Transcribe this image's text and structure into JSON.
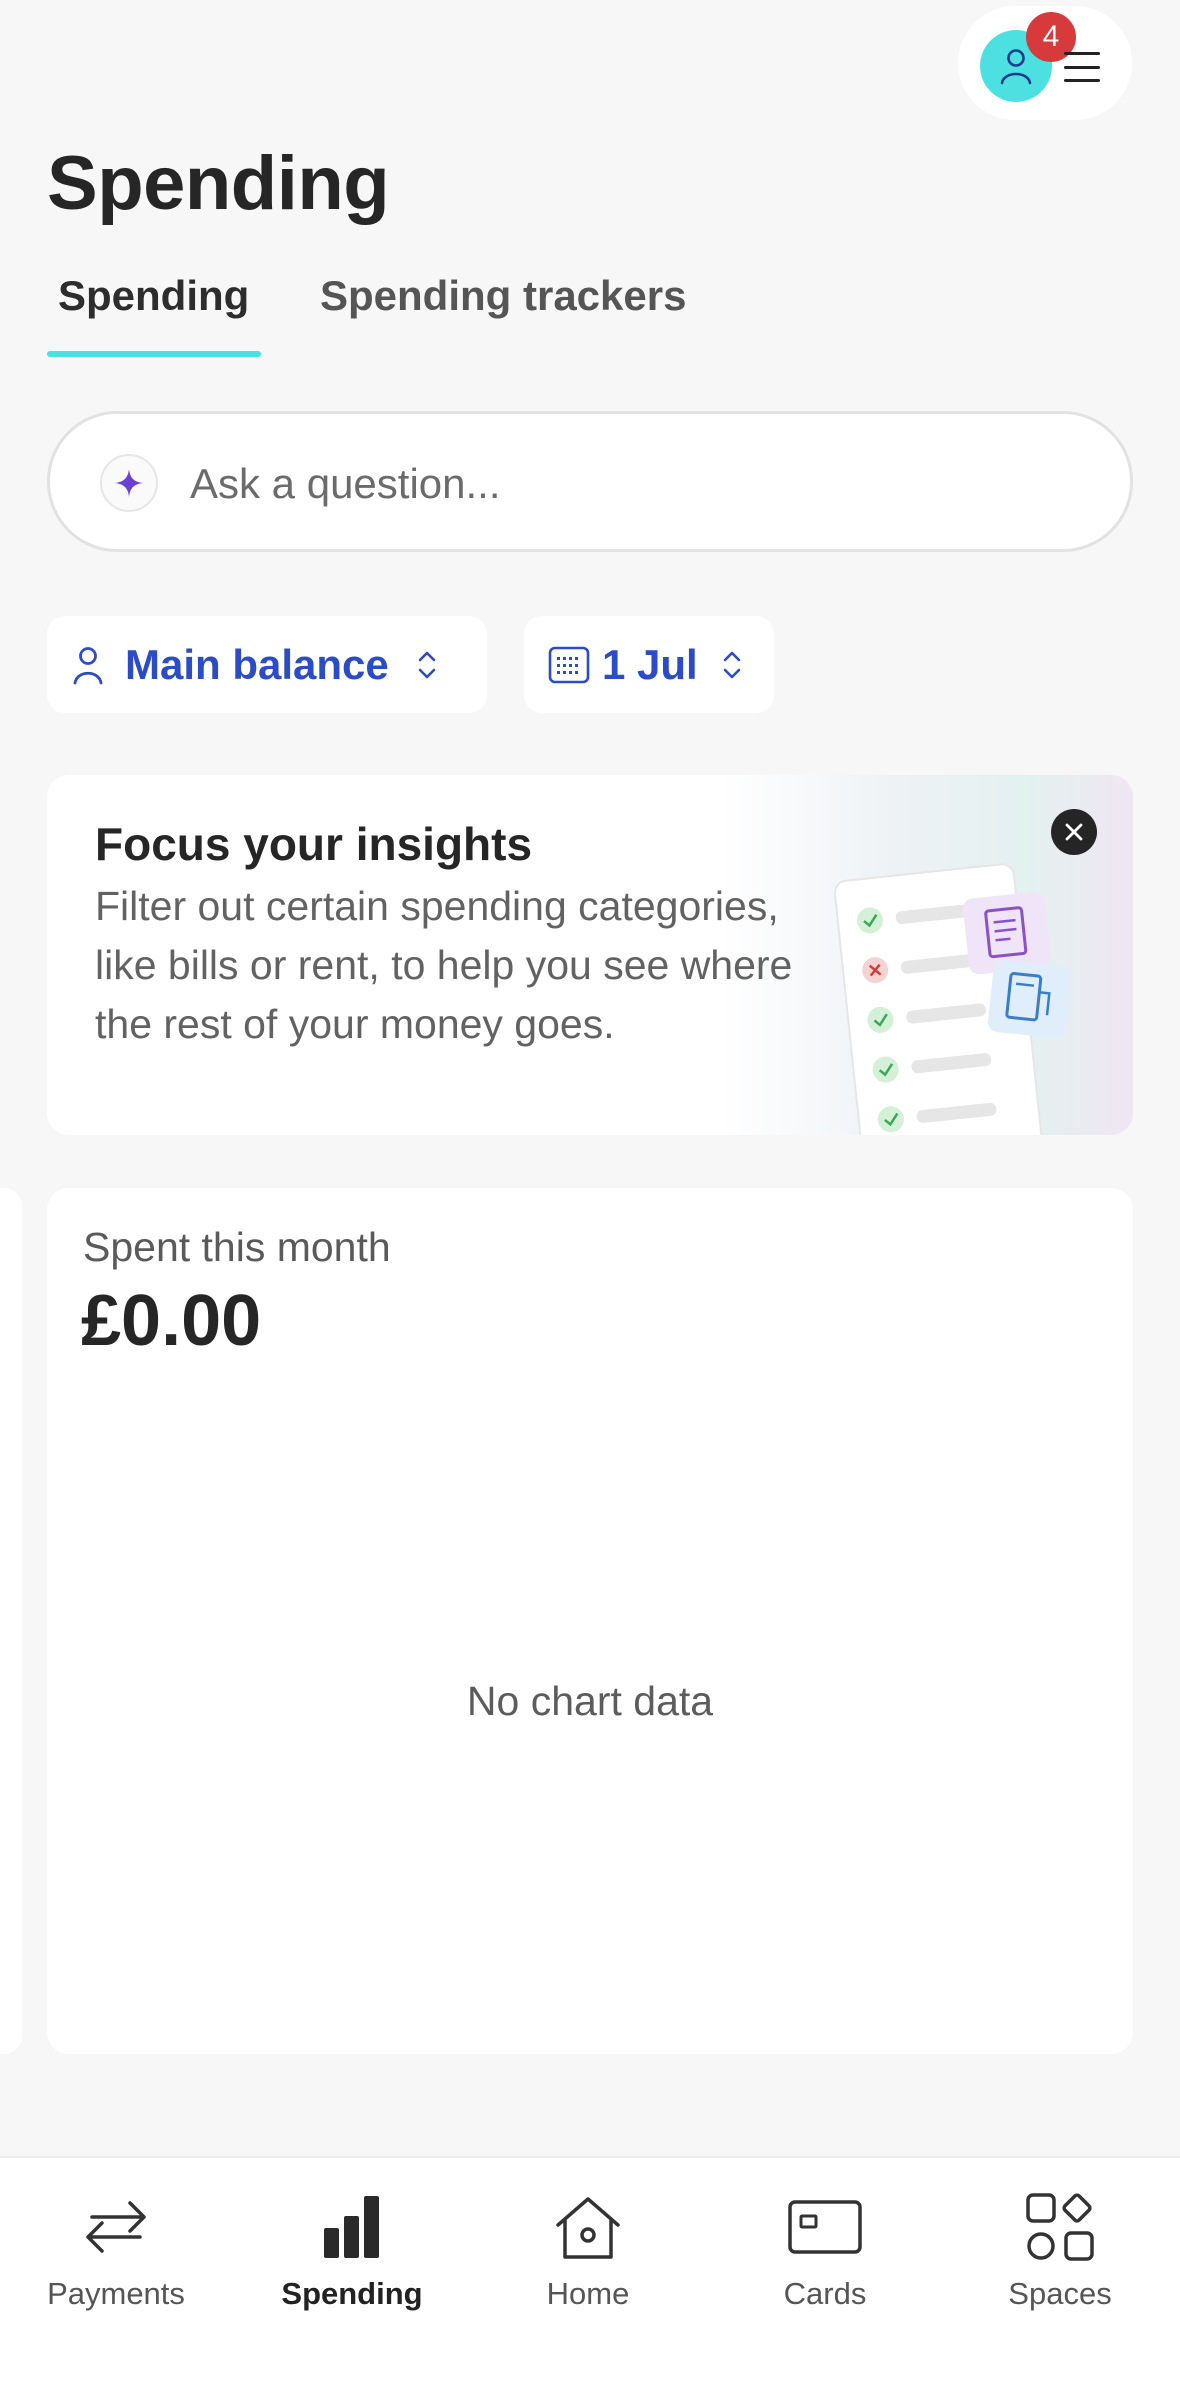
{
  "header": {
    "notification_count": "4",
    "page_title": "Spending"
  },
  "tabs": [
    {
      "label": "Spending",
      "active": true
    },
    {
      "label": "Spending trackers",
      "active": false
    }
  ],
  "search": {
    "placeholder": "Ask a question..."
  },
  "filters": {
    "account_label": "Main balance",
    "date_label": "1 Jul"
  },
  "insight": {
    "title": "Focus your insights",
    "body": "Filter out certain spending categories, like bills or rent, to help you see where the rest of your money goes."
  },
  "spent": {
    "label": "Spent this month",
    "amount": "£0.00",
    "empty_message": "No chart data"
  },
  "bottom_nav": [
    {
      "label": "Payments",
      "icon": "transfer-arrows-icon",
      "active": false
    },
    {
      "label": "Spending",
      "icon": "bar-chart-icon",
      "active": true
    },
    {
      "label": "Home",
      "icon": "home-icon",
      "active": false
    },
    {
      "label": "Cards",
      "icon": "card-icon",
      "active": false
    },
    {
      "label": "Spaces",
      "icon": "spaces-grid-icon",
      "active": false
    }
  ],
  "colors": {
    "accent_teal": "#4de0e0",
    "link_blue": "#2b4bc8",
    "badge_red": "#d63a3a",
    "background": "#f7f7f7"
  }
}
